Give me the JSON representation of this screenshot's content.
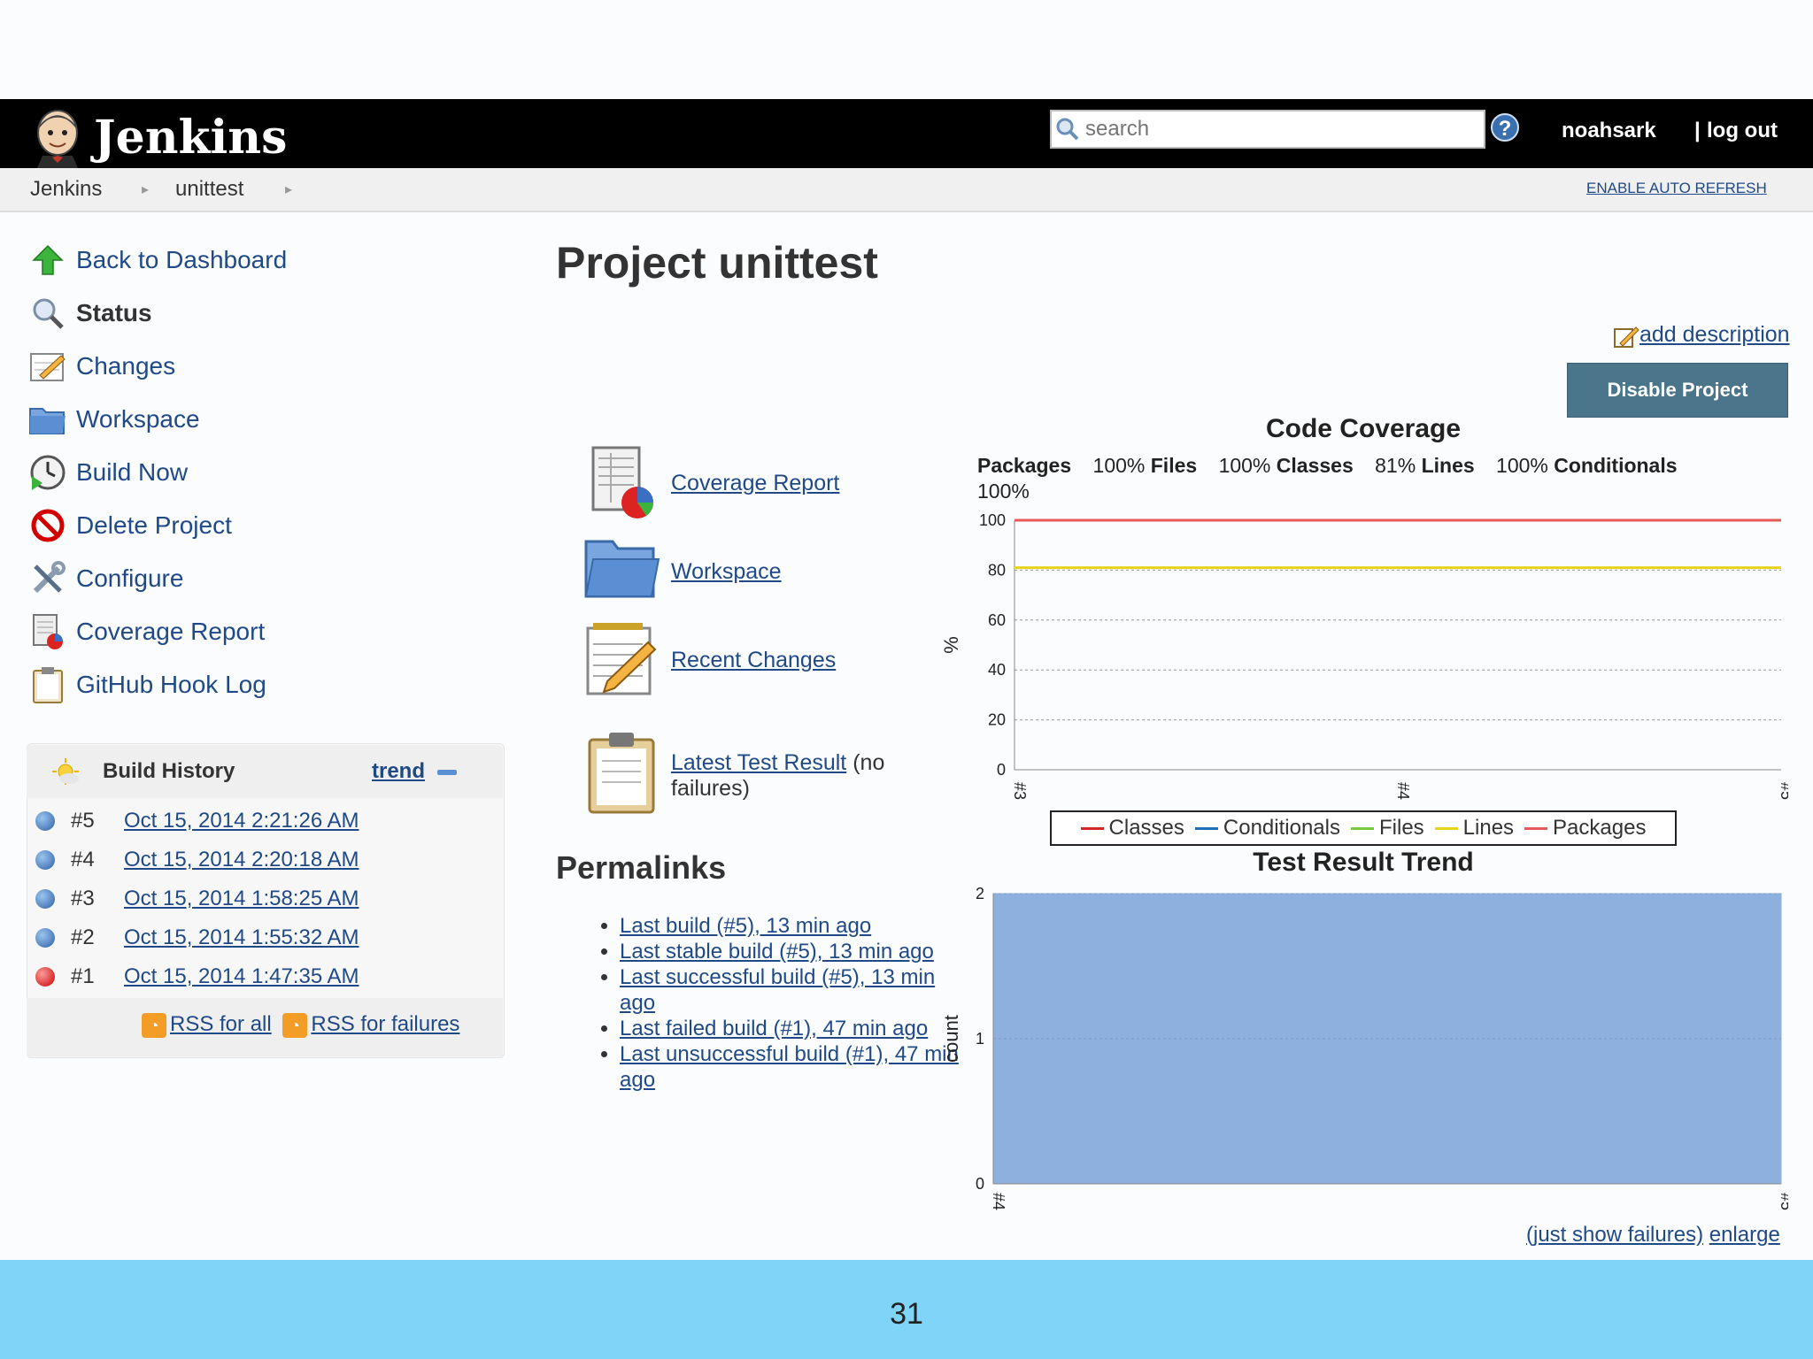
{
  "header": {
    "app_name": "Jenkins",
    "search_placeholder": "search",
    "help": "?",
    "user": "noahsark",
    "logout": "log out"
  },
  "breadcrumb": {
    "items": [
      "Jenkins",
      "unittest"
    ],
    "auto_refresh": "ENABLE AUTO REFRESH"
  },
  "sidebar": {
    "items": [
      {
        "label": "Back to Dashboard",
        "icon": "up-arrow-icon"
      },
      {
        "label": "Status",
        "icon": "magnifier-icon"
      },
      {
        "label": "Changes",
        "icon": "notepad-icon"
      },
      {
        "label": "Workspace",
        "icon": "folder-icon"
      },
      {
        "label": "Build Now",
        "icon": "clock-play-icon"
      },
      {
        "label": "Delete Project",
        "icon": "no-entry-icon"
      },
      {
        "label": "Configure",
        "icon": "tools-icon"
      },
      {
        "label": "Coverage Report",
        "icon": "coverage-report-icon"
      },
      {
        "label": "GitHub Hook Log",
        "icon": "clipboard-icon"
      }
    ]
  },
  "build_history": {
    "title": "Build History",
    "trend": "trend",
    "builds": [
      {
        "num": "#5",
        "date": "Oct 15, 2014 2:21:26 AM",
        "status": "success"
      },
      {
        "num": "#4",
        "date": "Oct 15, 2014 2:20:18 AM",
        "status": "success"
      },
      {
        "num": "#3",
        "date": "Oct 15, 2014 1:58:25 AM",
        "status": "success"
      },
      {
        "num": "#2",
        "date": "Oct 15, 2014 1:55:32 AM",
        "status": "success"
      },
      {
        "num": "#1",
        "date": "Oct 15, 2014 1:47:35 AM",
        "status": "failed"
      }
    ],
    "rss_all": "RSS for all",
    "rss_failures": "RSS for failures"
  },
  "main": {
    "title": "Project unittest",
    "add_description": "add description",
    "disable_button": "Disable Project",
    "links": [
      {
        "label": "Coverage Report",
        "suffix": "",
        "icon": "coverage-report-icon"
      },
      {
        "label": "Workspace",
        "suffix": "",
        "icon": "folder-icon"
      },
      {
        "label": "Recent Changes",
        "suffix": "",
        "icon": "notepad-icon"
      },
      {
        "label": "Latest Test Result",
        "suffix": " (no failures)",
        "icon": "clipboard-icon"
      }
    ],
    "permalinks_title": "Permalinks",
    "permalinks": [
      "Last build (#5), 13 min ago",
      "Last stable build (#5), 13 min ago",
      "Last successful build (#5), 13 min ago",
      "Last failed build (#1), 47 min ago",
      "Last unsuccessful build (#1), 47 min ago"
    ],
    "just_show_failures": "(just show failures)",
    "enlarge": "enlarge"
  },
  "chart_data": [
    {
      "type": "line",
      "title": "Code Coverage",
      "summary": [
        {
          "label": "Packages",
          "value": "100%"
        },
        {
          "label": "Files",
          "value": "100%"
        },
        {
          "label": "Classes",
          "value": "100%"
        },
        {
          "label": "Lines",
          "value": "81%"
        },
        {
          "label": "Conditionals",
          "value": "100%"
        }
      ],
      "x": [
        "#3",
        "#4",
        "#5"
      ],
      "ylabel": "%",
      "ylim": [
        0,
        100
      ],
      "yticks": [
        "0",
        "20",
        "40",
        "60",
        "80",
        "100"
      ],
      "grid": true,
      "legend": [
        "Classes",
        "Conditionals",
        "Files",
        "Lines",
        "Packages"
      ],
      "legend_placement": "bottom",
      "series": [
        {
          "name": "Classes",
          "color": "#d62728",
          "values": [
            100,
            100,
            100
          ]
        },
        {
          "name": "Conditionals",
          "color": "#1f6fb4",
          "values": [
            100,
            100,
            100
          ]
        },
        {
          "name": "Files",
          "color": "#7ac943",
          "values": [
            100,
            100,
            100
          ]
        },
        {
          "name": "Lines",
          "color": "#e6d31c",
          "values": [
            81,
            81,
            81
          ]
        },
        {
          "name": "Packages",
          "color": "#e85a5a",
          "values": [
            100,
            100,
            100
          ]
        }
      ]
    },
    {
      "type": "area",
      "title": "Test Result Trend",
      "x": [
        "#4",
        "#5"
      ],
      "ylabel": "count",
      "ylim": [
        0,
        2
      ],
      "yticks": [
        "0",
        "1",
        "2"
      ],
      "grid": true,
      "series": [
        {
          "color": "#8eb0de",
          "values": [
            2,
            2
          ]
        }
      ]
    }
  ],
  "footer": {
    "slide_number": "31"
  }
}
